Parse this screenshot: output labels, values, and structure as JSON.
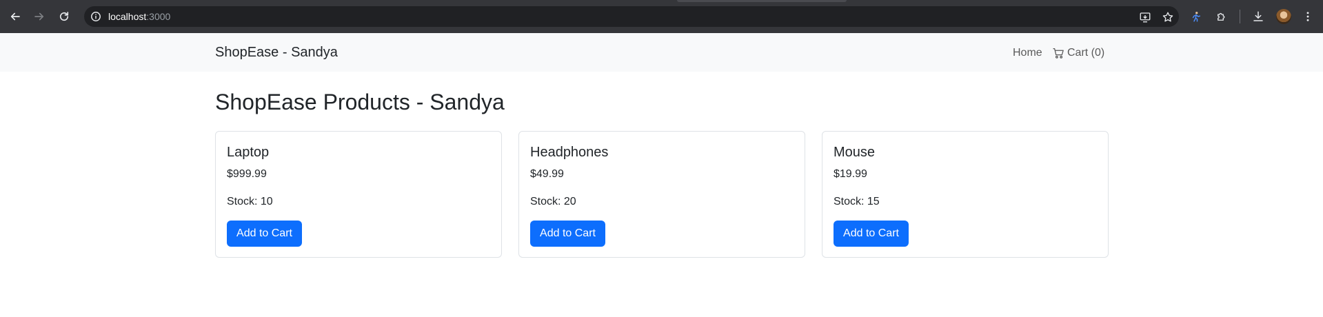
{
  "browser": {
    "url_host": "localhost",
    "url_port": ":3000"
  },
  "navbar": {
    "brand": "ShopEase - Sandya",
    "home_label": "Home",
    "cart_label": "Cart (0)"
  },
  "page": {
    "title": "ShopEase Products - Sandya"
  },
  "products": [
    {
      "name": "Laptop",
      "price": "$999.99",
      "stock": "Stock: 10",
      "button": "Add to Cart"
    },
    {
      "name": "Headphones",
      "price": "$49.99",
      "stock": "Stock: 20",
      "button": "Add to Cart"
    },
    {
      "name": "Mouse",
      "price": "$19.99",
      "stock": "Stock: 15",
      "button": "Add to Cart"
    }
  ],
  "colors": {
    "primary": "#0d6efd",
    "navbar_bg": "#f8f9fa",
    "browser_bg": "#35363a"
  }
}
